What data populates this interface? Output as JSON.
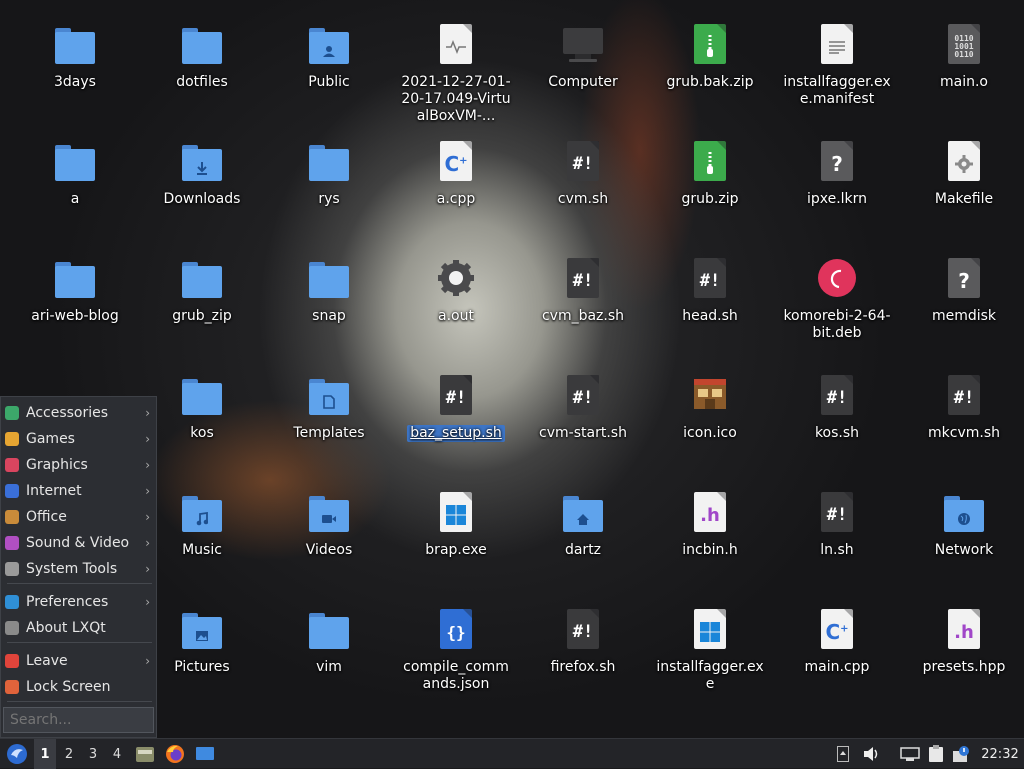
{
  "desktop": {
    "icons": [
      {
        "label": "3days",
        "type": "folder",
        "emblem": ""
      },
      {
        "label": "dotfiles",
        "type": "folder",
        "emblem": ""
      },
      {
        "label": "Public",
        "type": "folder",
        "emblem": "user-emblem"
      },
      {
        "label": "2021-12-27-01-20-17.049-VirtualBoxVM-...",
        "type": "doc",
        "page": "white",
        "emblem": "log-wave-glyph"
      },
      {
        "label": "Computer",
        "type": "computer",
        "emblem": ""
      },
      {
        "label": "grub.bak.zip",
        "type": "doc",
        "page": "green",
        "emblem": "zip-glyph"
      },
      {
        "label": "installfagger.exe.manifest",
        "type": "doc",
        "page": "white",
        "emblem": "text-lines-glyph"
      },
      {
        "label": "main.o",
        "type": "doc",
        "page": "grey",
        "emblem": "binary-glyph"
      },
      {
        "label": "a",
        "type": "folder",
        "emblem": ""
      },
      {
        "label": "Downloads",
        "type": "folder",
        "emblem": "download-emblem"
      },
      {
        "label": "rys",
        "type": "folder",
        "emblem": ""
      },
      {
        "label": "a.cpp",
        "type": "doc",
        "page": "white",
        "emblem": "cpp-glyph"
      },
      {
        "label": "cvm.sh",
        "type": "doc",
        "page": "dark",
        "emblem": "shell-glyph"
      },
      {
        "label": "grub.zip",
        "type": "doc",
        "page": "green",
        "emblem": "zip-glyph"
      },
      {
        "label": "ipxe.lkrn",
        "type": "doc",
        "page": "grey",
        "emblem": "question-glyph"
      },
      {
        "label": "Makefile",
        "type": "doc",
        "page": "white",
        "emblem": "gear-glyph"
      },
      {
        "label": "ari-web-blog",
        "type": "folder",
        "emblem": ""
      },
      {
        "label": "grub_zip",
        "type": "folder",
        "emblem": ""
      },
      {
        "label": "snap",
        "type": "folder",
        "emblem": ""
      },
      {
        "label": "a.out",
        "type": "gear",
        "emblem": ""
      },
      {
        "label": "cvm_baz.sh",
        "type": "doc",
        "page": "dark",
        "emblem": "shell-glyph"
      },
      {
        "label": "head.sh",
        "type": "doc",
        "page": "dark",
        "emblem": "shell-glyph"
      },
      {
        "label": "komorebi-2-64-bit.deb",
        "type": "deb",
        "emblem": ""
      },
      {
        "label": "memdisk",
        "type": "doc",
        "page": "grey",
        "emblem": "question-glyph"
      },
      {
        "label": "kos",
        "type": "folder",
        "emblem": ""
      },
      {
        "label": "Templates",
        "type": "folder",
        "emblem": "template-emblem"
      },
      {
        "label": "baz_setup.sh",
        "type": "doc",
        "page": "dark",
        "emblem": "shell-glyph",
        "selected": true
      },
      {
        "label": "cvm-start.sh",
        "type": "doc",
        "page": "dark",
        "emblem": "shell-glyph"
      },
      {
        "label": "icon.ico",
        "type": "ico",
        "emblem": ""
      },
      {
        "label": "kos.sh",
        "type": "doc",
        "page": "dark",
        "emblem": "shell-glyph"
      },
      {
        "label": "mkcvm.sh",
        "type": "doc",
        "page": "dark",
        "emblem": "shell-glyph"
      },
      {
        "label": "Music",
        "type": "folder",
        "emblem": "music-emblem"
      },
      {
        "label": "Videos",
        "type": "folder",
        "emblem": "video-emblem"
      },
      {
        "label": "brap.exe",
        "type": "doc",
        "page": "white",
        "emblem": "windows-glyph"
      },
      {
        "label": "dartz",
        "type": "folder",
        "emblem": "home-emblem"
      },
      {
        "label": "incbin.h",
        "type": "doc",
        "page": "white",
        "emblem": "header-glyph"
      },
      {
        "label": "ln.sh",
        "type": "doc",
        "page": "dark",
        "emblem": "shell-glyph"
      },
      {
        "label": "Network",
        "type": "folder",
        "emblem": "globe-emblem"
      },
      {
        "label": "Pictures",
        "type": "folder",
        "emblem": "picture-emblem"
      },
      {
        "label": "vim",
        "type": "folder",
        "emblem": ""
      },
      {
        "label": "compile_commands.json",
        "type": "doc",
        "page": "blue",
        "emblem": "json-glyph"
      },
      {
        "label": "firefox.sh",
        "type": "doc",
        "page": "dark",
        "emblem": "shell-glyph"
      },
      {
        "label": "installfagger.exe",
        "type": "doc",
        "page": "white",
        "emblem": "windows-glyph"
      },
      {
        "label": "main.cpp",
        "type": "doc",
        "page": "white",
        "emblem": "cpp-glyph"
      },
      {
        "label": "presets.hpp",
        "type": "doc",
        "page": "white",
        "emblem": "header-glyph"
      }
    ]
  },
  "start_menu": {
    "items": [
      {
        "label": "Accessories",
        "icon": "accessories-icon",
        "color": "#3ca86a",
        "arrow": "›"
      },
      {
        "label": "Games",
        "icon": "games-icon",
        "color": "#e6a532",
        "arrow": "›"
      },
      {
        "label": "Graphics",
        "icon": "graphics-icon",
        "color": "#d9455f",
        "arrow": "›"
      },
      {
        "label": "Internet",
        "icon": "internet-icon",
        "color": "#3a6fd8",
        "arrow": "›"
      },
      {
        "label": "Office",
        "icon": "office-icon",
        "color": "#c98b3a",
        "arrow": "›"
      },
      {
        "label": "Sound & Video",
        "icon": "sound-video-icon",
        "color": "#b04fc2",
        "arrow": "›"
      },
      {
        "label": "System Tools",
        "icon": "system-tools-icon",
        "color": "#9a9a9a",
        "arrow": "›"
      },
      {
        "label": "Preferences",
        "icon": "preferences-icon",
        "color": "#2f8fd6",
        "arrow": "›"
      },
      {
        "label": "About LXQt",
        "icon": "info-icon",
        "color": "#8a8a8a",
        "arrow": ""
      },
      {
        "label": "Leave",
        "icon": "power-icon",
        "color": "#e0443b",
        "arrow": "›"
      },
      {
        "label": "Lock Screen",
        "icon": "lock-icon",
        "color": "#e0633b",
        "arrow": ""
      }
    ],
    "search_placeholder": "Search..."
  },
  "taskbar": {
    "workspaces": [
      "1",
      "2",
      "3",
      "4"
    ],
    "active_workspace": "1",
    "clock": "22:32",
    "launchers": [
      "file-manager-icon",
      "firefox-icon",
      "show-desktop-icon"
    ],
    "tray": [
      "tray-expander-icon",
      "volume-icon",
      "network-icon",
      "clipboard-icon",
      "updates-icon"
    ],
    "accent": "#3d75c6"
  }
}
